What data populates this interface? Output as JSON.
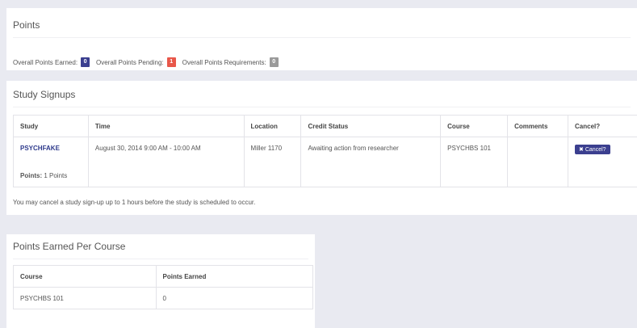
{
  "points": {
    "title": "Points",
    "earned_label": "Overall Points Earned:",
    "earned_value": "0",
    "pending_label": "Overall Points Pending:",
    "pending_value": "1",
    "requirements_label": "Overall Points Requirements:",
    "requirements_value": "0",
    "colors": {
      "earned": "#3b3f8f",
      "pending": "#e8574a",
      "requirements": "#9a9a9a"
    }
  },
  "signups": {
    "title": "Study Signups",
    "columns": [
      "Study",
      "Time",
      "Location",
      "Credit Status",
      "Course",
      "Comments",
      "Cancel?"
    ],
    "rows": [
      {
        "study": "PSYCHFAKE",
        "points_label": "Points:",
        "points_value": "1 Points",
        "time": "August 30, 2014 9:00 AM - 10:00 AM",
        "location": "Miller 1170",
        "credit_status": "Awaiting action from researcher",
        "course": "PSYCHBS 101",
        "comments": "",
        "cancel_label": "Cancel?"
      }
    ],
    "note": "You may cancel a study sign-up up to 1 hours before the study is scheduled to occur."
  },
  "course_points": {
    "title": "Points Earned Per Course",
    "columns": [
      "Course",
      "Points Earned"
    ],
    "rows": [
      {
        "course": "PSYCHBS 101",
        "points": "0"
      }
    ]
  }
}
